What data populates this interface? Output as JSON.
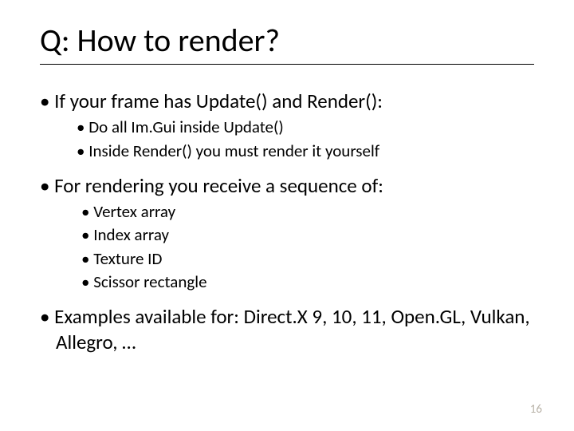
{
  "title": "Q: How to render?",
  "bullets": {
    "b1": "If your frame has Update() and Render():",
    "b1_sub": {
      "s1": "Do all Im.Gui inside Update()",
      "s2": "Inside Render() you must render it yourself"
    },
    "b2": "For rendering you receive a sequence of:",
    "b2_sub": {
      "s1": "Vertex array",
      "s2": "Index array",
      "s3": "Texture ID",
      "s4": "Scissor rectangle"
    },
    "b3": "Examples available for: Direct.X 9, 10, 11, Open.GL, Vulkan, Allegro, …"
  },
  "page_number": "16"
}
